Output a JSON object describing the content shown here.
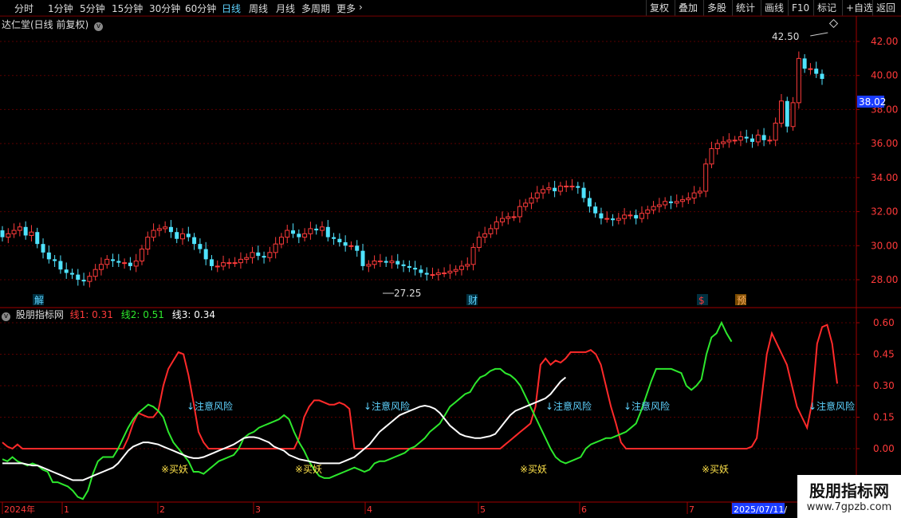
{
  "toolbar": {
    "periods": [
      "分时",
      "1分钟",
      "5分钟",
      "15分钟",
      "30分钟",
      "60分钟",
      "日线",
      "周线",
      "月线",
      "多周期",
      "更多"
    ],
    "active_period": "日线",
    "right_buttons": [
      "复权",
      "叠加",
      "多股",
      "统计",
      "画线",
      "F10",
      "标记",
      "+自选",
      "返回"
    ]
  },
  "main": {
    "title": "达仁堂(日线 前复权)",
    "price_label": "38.02",
    "high_label": "42.50",
    "low_label": "27.25"
  },
  "indicator": {
    "title": "股朋指标网",
    "line1_label": "线1: 0.31",
    "line2_label": "线2: 0.51",
    "line3_label": "线3: 0.34"
  },
  "watermark": {
    "title": "股朋指标网",
    "url": "www.7gpzb.com"
  },
  "chart_data": [
    {
      "type": "candlestick",
      "title": "达仁堂(日线 前复权)",
      "y_ticks": [
        28.0,
        30.0,
        32.0,
        34.0,
        36.0,
        38.0,
        40.0,
        42.0
      ],
      "ylim": [
        26.7,
        43.3
      ],
      "series_open": [
        30.9,
        30.5,
        30.7,
        30.9,
        31.1,
        30.6,
        30.8,
        30.1,
        29.6,
        29.2,
        29.1,
        28.6,
        28.4,
        28.3,
        28.0,
        27.9,
        28.2,
        28.6,
        28.9,
        29.2,
        29.1,
        29.0,
        29.0,
        28.8,
        29.1,
        29.8,
        30.5,
        30.9,
        31.0,
        31.1,
        30.8,
        30.4,
        30.7,
        30.5,
        30.1,
        29.8,
        29.2,
        28.8,
        28.8,
        29.0,
        29.0,
        29.0,
        29.2,
        29.3,
        29.6,
        29.4,
        29.3,
        29.6,
        30.1,
        30.5,
        30.9,
        30.7,
        30.5,
        30.7,
        31.0,
        30.9,
        31.1,
        30.5,
        30.4,
        30.2,
        30.0,
        30.0,
        29.7,
        28.8,
        28.9,
        29.1,
        29.1,
        29.0,
        29.1,
        28.9,
        28.8,
        28.7,
        28.6,
        28.4,
        28.3,
        28.3,
        28.4,
        28.4,
        28.5,
        28.6,
        28.8,
        28.9,
        29.9,
        30.5,
        30.7,
        31.0,
        31.4,
        31.6,
        31.7,
        31.7,
        32.3,
        32.5,
        32.8,
        33.1,
        33.3,
        33.4,
        33.2,
        33.5,
        33.5,
        33.5,
        33.4,
        32.8,
        32.3,
        31.9,
        31.6,
        31.6,
        31.5,
        31.6,
        31.8,
        31.8,
        31.6,
        31.9,
        32.1,
        32.3,
        32.4,
        32.6,
        32.5,
        32.6,
        32.7,
        32.8,
        33.1,
        33.2,
        34.8,
        35.7,
        36.0,
        36.1,
        36.2,
        36.2,
        36.4,
        36.3,
        36.1,
        36.5,
        36.2,
        36.2,
        37.2,
        38.5,
        37.0,
        38.4,
        41.0,
        40.4,
        40.4,
        40.1
      ],
      "series_close": [
        30.5,
        30.7,
        30.9,
        31.1,
        30.6,
        30.8,
        30.1,
        29.6,
        29.2,
        29.1,
        28.6,
        28.4,
        28.3,
        28.0,
        27.9,
        28.2,
        28.6,
        28.9,
        29.2,
        29.1,
        29.0,
        29.0,
        28.8,
        29.1,
        29.8,
        30.5,
        30.9,
        31.0,
        31.1,
        30.8,
        30.4,
        30.7,
        30.5,
        30.1,
        29.8,
        29.2,
        28.8,
        28.8,
        29.0,
        29.0,
        29.0,
        29.2,
        29.3,
        29.6,
        29.4,
        29.3,
        29.6,
        30.1,
        30.5,
        30.9,
        30.7,
        30.5,
        30.7,
        31.0,
        30.9,
        31.1,
        30.5,
        30.4,
        30.2,
        30.0,
        30.0,
        29.7,
        28.8,
        28.9,
        29.1,
        29.1,
        29.0,
        29.1,
        28.9,
        28.8,
        28.7,
        28.6,
        28.4,
        28.3,
        28.3,
        28.4,
        28.4,
        28.5,
        28.6,
        28.8,
        28.9,
        29.9,
        30.5,
        30.7,
        31.0,
        31.4,
        31.6,
        31.7,
        31.7,
        32.3,
        32.5,
        32.8,
        33.1,
        33.3,
        33.4,
        33.2,
        33.5,
        33.5,
        33.5,
        33.4,
        32.8,
        32.3,
        31.9,
        31.6,
        31.6,
        31.5,
        31.6,
        31.8,
        31.8,
        31.6,
        31.9,
        32.1,
        32.3,
        32.4,
        32.6,
        32.5,
        32.6,
        32.7,
        32.8,
        33.1,
        33.2,
        34.8,
        35.7,
        36.0,
        36.1,
        36.2,
        36.2,
        36.4,
        36.3,
        36.1,
        36.5,
        36.2,
        36.2,
        37.2,
        38.5,
        37.0,
        38.4,
        41.0,
        40.4,
        40.4,
        40.1,
        39.8
      ]
    },
    {
      "type": "line",
      "title": "股朋指标网",
      "y_ticks": [
        0.0,
        0.15,
        0.3,
        0.45,
        0.6
      ],
      "ylim": [
        -0.26,
        0.69
      ],
      "x_tick_labels": [
        "2024年",
        "1",
        "2",
        "3",
        "4",
        "5",
        "6",
        "7",
        "2025/07/11/"
      ],
      "annotations": [
        "↓注意风险",
        "↓注意风险",
        "↓注意风险",
        "↓注意风险",
        "↓注意风险",
        "※买妖",
        "※买妖",
        "※买妖",
        "※买妖",
        "解",
        "财",
        "$",
        "预"
      ],
      "series": [
        {
          "name": "线1",
          "color": "#ff2a2a",
          "values": [
            0.03,
            0.01,
            0.0,
            0.02,
            0.0,
            0.0,
            0.0,
            0.0,
            0.0,
            0.0,
            0.0,
            0.0,
            0.0,
            0.0,
            0.0,
            0.0,
            0.0,
            0.0,
            0.0,
            0.0,
            0.0,
            0.0,
            0.0,
            0.0,
            0.0,
            0.05,
            0.12,
            0.17,
            0.16,
            0.15,
            0.15,
            0.18,
            0.3,
            0.38,
            0.42,
            0.46,
            0.45,
            0.35,
            0.22,
            0.08,
            0.03,
            0.0,
            0.0,
            0.0,
            0.0,
            0.0,
            0.0,
            0.0,
            0.0,
            0.0,
            0.0,
            0.0,
            0.0,
            0.0,
            0.0,
            0.0,
            0.0,
            0.0,
            0.0,
            0.05,
            0.15,
            0.2,
            0.23,
            0.23,
            0.22,
            0.21,
            0.21,
            0.22,
            0.21,
            0.19,
            0.0,
            0.0,
            0.0,
            0.0,
            0.0,
            0.0,
            0.0,
            0.0,
            0.0,
            0.0,
            0.0,
            0.0,
            0.0,
            0.0,
            0.0,
            0.0,
            0.0,
            0.0,
            0.0,
            0.0,
            0.0,
            0.0,
            0.0,
            0.0,
            0.0,
            0.0,
            0.0,
            0.0,
            0.0,
            0.0,
            0.02,
            0.04,
            0.06,
            0.08,
            0.1,
            0.12,
            0.2,
            0.4,
            0.43,
            0.4,
            0.42,
            0.41,
            0.43,
            0.46,
            0.46,
            0.46,
            0.46,
            0.47,
            0.45,
            0.4,
            0.3,
            0.2,
            0.12,
            0.03,
            0.0,
            0.0,
            0.0,
            0.0,
            0.0,
            0.0,
            0.0,
            0.0,
            0.0,
            0.0,
            0.0,
            0.0,
            0.0,
            0.0,
            0.0,
            0.0,
            0.0,
            0.0,
            0.0,
            0.0,
            0.0,
            0.0,
            0.0,
            0.0,
            0.0,
            0.01,
            0.05,
            0.25,
            0.45,
            0.55,
            0.5,
            0.45,
            0.4,
            0.3,
            0.2,
            0.15,
            0.1,
            0.22,
            0.5,
            0.58,
            0.59,
            0.5,
            0.31
          ]
        },
        {
          "name": "线2",
          "color": "#2de82d",
          "values": [
            -0.05,
            -0.06,
            -0.04,
            -0.06,
            -0.07,
            -0.08,
            -0.07,
            -0.08,
            -0.1,
            -0.11,
            -0.16,
            -0.16,
            -0.17,
            -0.18,
            -0.2,
            -0.23,
            -0.24,
            -0.2,
            -0.12,
            -0.06,
            -0.04,
            -0.04,
            -0.04,
            0.0,
            0.05,
            0.1,
            0.14,
            0.17,
            0.19,
            0.21,
            0.2,
            0.18,
            0.15,
            0.08,
            0.03,
            0.0,
            -0.03,
            -0.06,
            -0.11,
            -0.11,
            -0.12,
            -0.1,
            -0.08,
            -0.06,
            -0.05,
            -0.04,
            -0.03,
            0.0,
            0.05,
            0.07,
            0.08,
            0.1,
            0.11,
            0.12,
            0.13,
            0.14,
            0.16,
            0.14,
            0.08,
            0.03,
            -0.01,
            -0.06,
            -0.1,
            -0.13,
            -0.14,
            -0.14,
            -0.13,
            -0.12,
            -0.11,
            -0.1,
            -0.09,
            -0.1,
            -0.11,
            -0.1,
            -0.07,
            -0.06,
            -0.06,
            -0.05,
            -0.04,
            -0.03,
            -0.02,
            0.0,
            0.01,
            0.03,
            0.05,
            0.08,
            0.1,
            0.12,
            0.16,
            0.2,
            0.22,
            0.24,
            0.26,
            0.27,
            0.31,
            0.34,
            0.35,
            0.37,
            0.38,
            0.38,
            0.36,
            0.35,
            0.33,
            0.3,
            0.25,
            0.2,
            0.15,
            0.1,
            0.05,
            0.0,
            -0.04,
            -0.06,
            -0.07,
            -0.06,
            -0.05,
            -0.04,
            0.0,
            0.02,
            0.03,
            0.04,
            0.05,
            0.05,
            0.06,
            0.07,
            0.08,
            0.1,
            0.12,
            0.18,
            0.25,
            0.32,
            0.38,
            0.38,
            0.38,
            0.38,
            0.37,
            0.36,
            0.3,
            0.28,
            0.3,
            0.33,
            0.45,
            0.53,
            0.55,
            0.6,
            0.55,
            0.51
          ]
        },
        {
          "name": "线3",
          "color": "#ffffff",
          "values": [
            -0.07,
            -0.07,
            -0.07,
            -0.07,
            -0.07,
            -0.075,
            -0.08,
            -0.08,
            -0.09,
            -0.1,
            -0.11,
            -0.12,
            -0.13,
            -0.14,
            -0.15,
            -0.15,
            -0.15,
            -0.14,
            -0.13,
            -0.12,
            -0.11,
            -0.1,
            -0.09,
            -0.07,
            -0.04,
            -0.01,
            0.01,
            0.02,
            0.03,
            0.03,
            0.025,
            0.02,
            0.01,
            0.0,
            -0.01,
            -0.02,
            -0.03,
            -0.04,
            -0.045,
            -0.045,
            -0.04,
            -0.03,
            -0.02,
            -0.01,
            0.0,
            0.01,
            0.02,
            0.035,
            0.05,
            0.055,
            0.055,
            0.05,
            0.04,
            0.03,
            0.01,
            0.0,
            -0.01,
            -0.03,
            -0.04,
            -0.05,
            -0.055,
            -0.06,
            -0.065,
            -0.07,
            -0.07,
            -0.07,
            -0.07,
            -0.07,
            -0.06,
            -0.05,
            -0.04,
            -0.02,
            0.0,
            0.02,
            0.05,
            0.08,
            0.1,
            0.12,
            0.14,
            0.16,
            0.17,
            0.18,
            0.19,
            0.2,
            0.205,
            0.2,
            0.19,
            0.17,
            0.14,
            0.11,
            0.09,
            0.07,
            0.06,
            0.055,
            0.05,
            0.05,
            0.055,
            0.06,
            0.07,
            0.1,
            0.13,
            0.16,
            0.18,
            0.19,
            0.2,
            0.21,
            0.22,
            0.23,
            0.24,
            0.26,
            0.29,
            0.32,
            0.34
          ]
        }
      ]
    }
  ]
}
